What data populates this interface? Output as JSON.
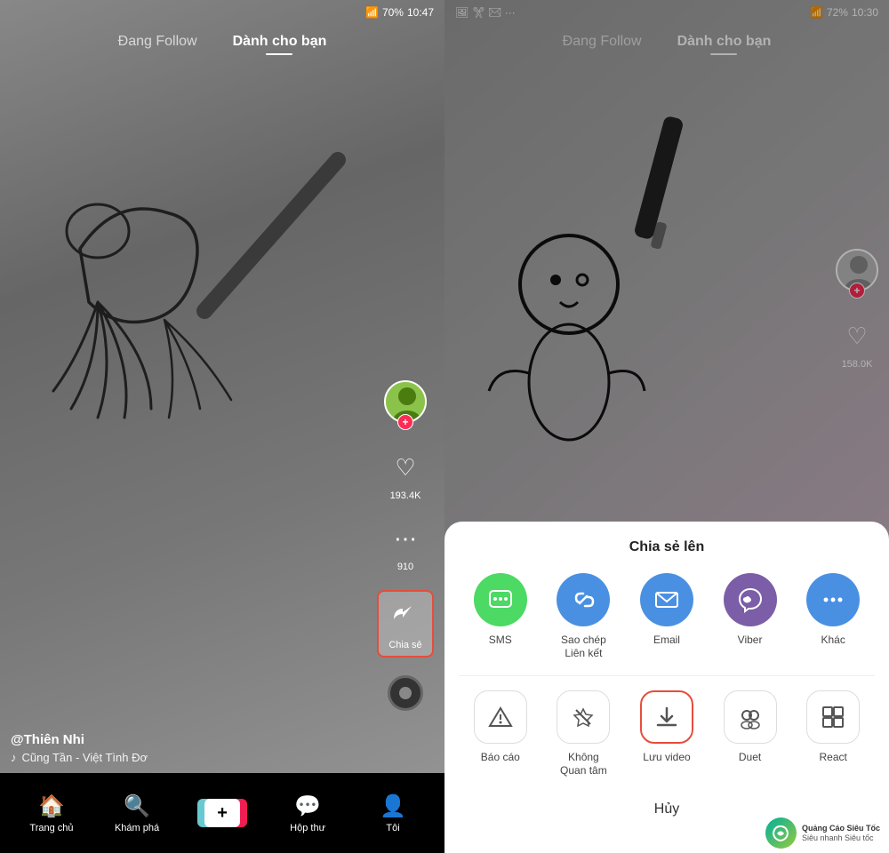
{
  "left_panel": {
    "status_bar": {
      "wifi": "📶",
      "signal": "📶",
      "battery": "70%",
      "time": "10:47"
    },
    "tabs": [
      {
        "label": "Đang Follow",
        "active": false
      },
      {
        "label": "Dành cho bạn",
        "active": true
      }
    ],
    "sidebar": {
      "like_count": "193.4K",
      "comment_count": "910",
      "share_label": "Chia sẻ"
    },
    "bottom_info": {
      "username": "@Thiên Nhi",
      "song": "♪  Cũng Tần - Việt  Tình Đơ"
    },
    "nav": [
      {
        "icon": "🏠",
        "label": "Trang chủ",
        "active": true
      },
      {
        "icon": "🔍",
        "label": "Khám phá"
      },
      {
        "icon": "+",
        "label": ""
      },
      {
        "icon": "💬",
        "label": "Hộp thư"
      },
      {
        "icon": "👤",
        "label": "Tôi"
      }
    ]
  },
  "right_panel": {
    "status_bar": {
      "battery": "72%",
      "time": "10:30"
    },
    "tabs": [
      {
        "label": "Đang Follow",
        "active": false
      },
      {
        "label": "Dành cho bạn",
        "active": true
      }
    ],
    "sidebar": {
      "like_count": "158.0K"
    },
    "share_panel": {
      "title": "Chia sẻ lên",
      "row1": [
        {
          "label": "SMS",
          "icon": "✉",
          "type": "sms"
        },
        {
          "label": "Sao chép\nLiên kết",
          "icon": "🔗",
          "type": "link"
        },
        {
          "label": "Email",
          "icon": "✉",
          "type": "email"
        },
        {
          "label": "Viber",
          "icon": "📞",
          "type": "viber"
        },
        {
          "label": "Khác",
          "icon": "•••",
          "type": "more"
        }
      ],
      "row2": [
        {
          "label": "Báo cáo",
          "icon": "⚠",
          "type": "report",
          "highlighted": false
        },
        {
          "label": "Không\nQuan tâm",
          "icon": "💔",
          "type": "not-interested",
          "highlighted": false
        },
        {
          "label": "Lưu video",
          "icon": "⬇",
          "type": "save-video",
          "highlighted": true
        },
        {
          "label": "Duet",
          "icon": "👥",
          "type": "duet",
          "highlighted": false
        },
        {
          "label": "React",
          "icon": "▣",
          "type": "react",
          "highlighted": false
        }
      ],
      "cancel_label": "Hủy"
    }
  }
}
